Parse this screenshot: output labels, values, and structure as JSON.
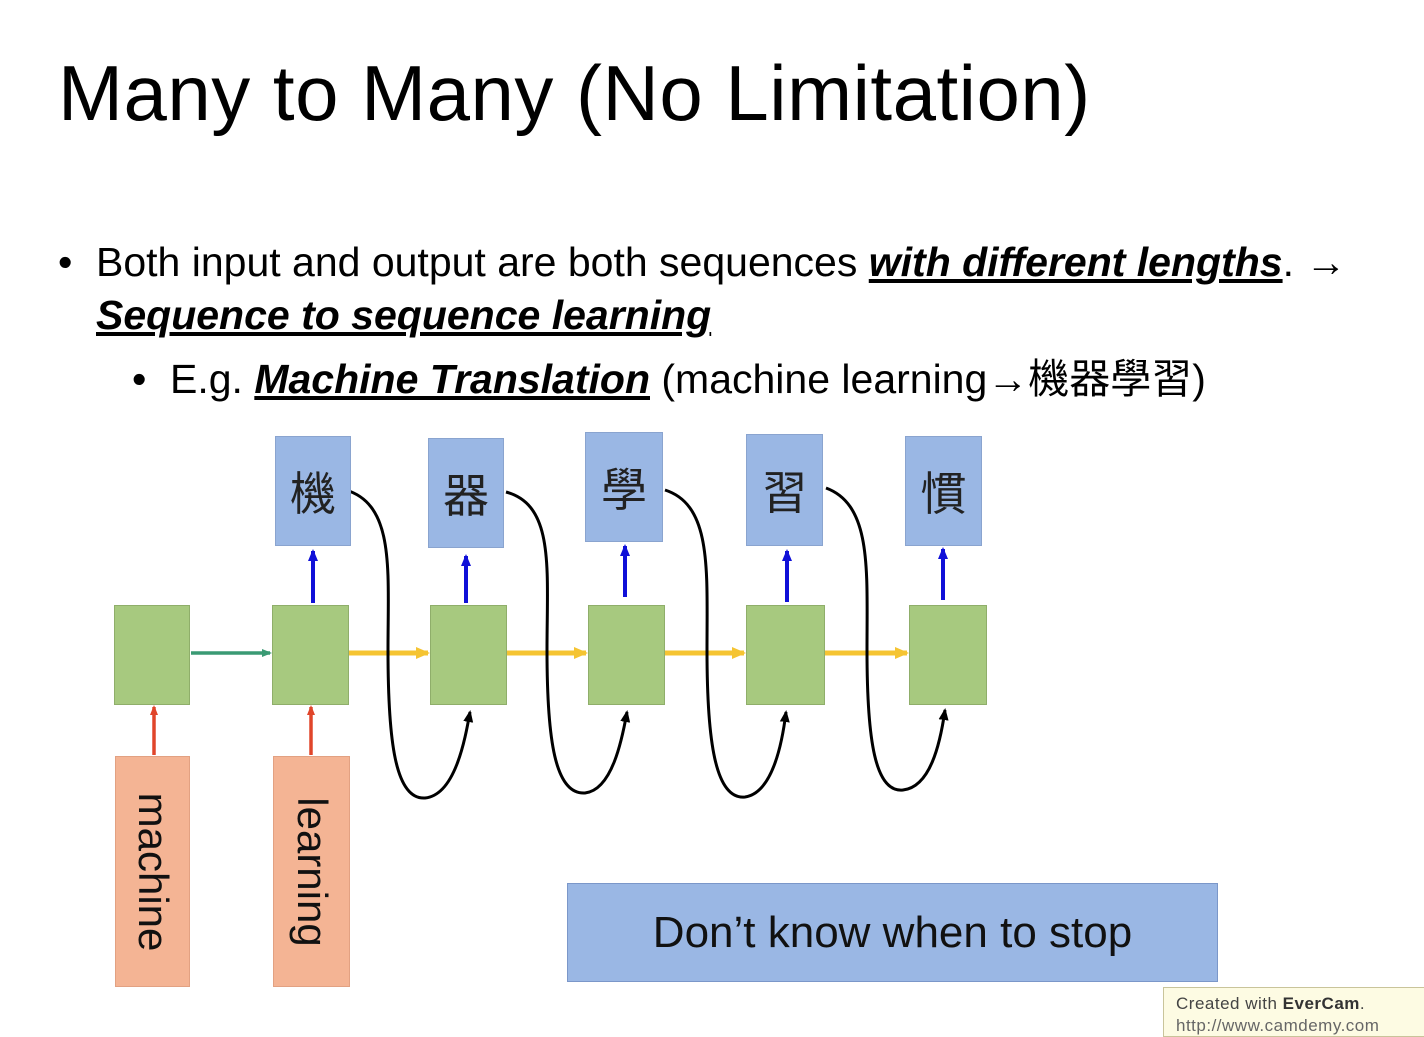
{
  "title": "Many to Many (No Limitation)",
  "bullet1": {
    "marker": "•",
    "text_a": "Both input and output are both sequences ",
    "em1": "with different lengths",
    "text_b": ". → ",
    "em2": "Sequence to sequence learning"
  },
  "bullet2": {
    "marker": "•",
    "text_a": "E.g. ",
    "em": "Machine Translation",
    "text_b": " (machine learning→機器學習)"
  },
  "diagram": {
    "outputs": [
      "機",
      "器",
      "學",
      "習",
      "慣"
    ],
    "inputs": [
      "machine",
      "learning"
    ],
    "colors": {
      "output_box": "#9ab7e4",
      "rnn_box": "#a7c97f",
      "input_box": "#f4b494",
      "encoder_arrow": "#3a9a74",
      "decoder_arrow": "#f5c432",
      "input_arrow": "#e0452a",
      "output_arrow": "#1010d8",
      "feedback_arrow": "#000000"
    }
  },
  "callout": "Don’t know when to stop",
  "watermark": {
    "line1_prefix": "Created with ",
    "brand": "EverCam",
    "line1_suffix": ".",
    "line2": "http://www.camdemy.com"
  }
}
